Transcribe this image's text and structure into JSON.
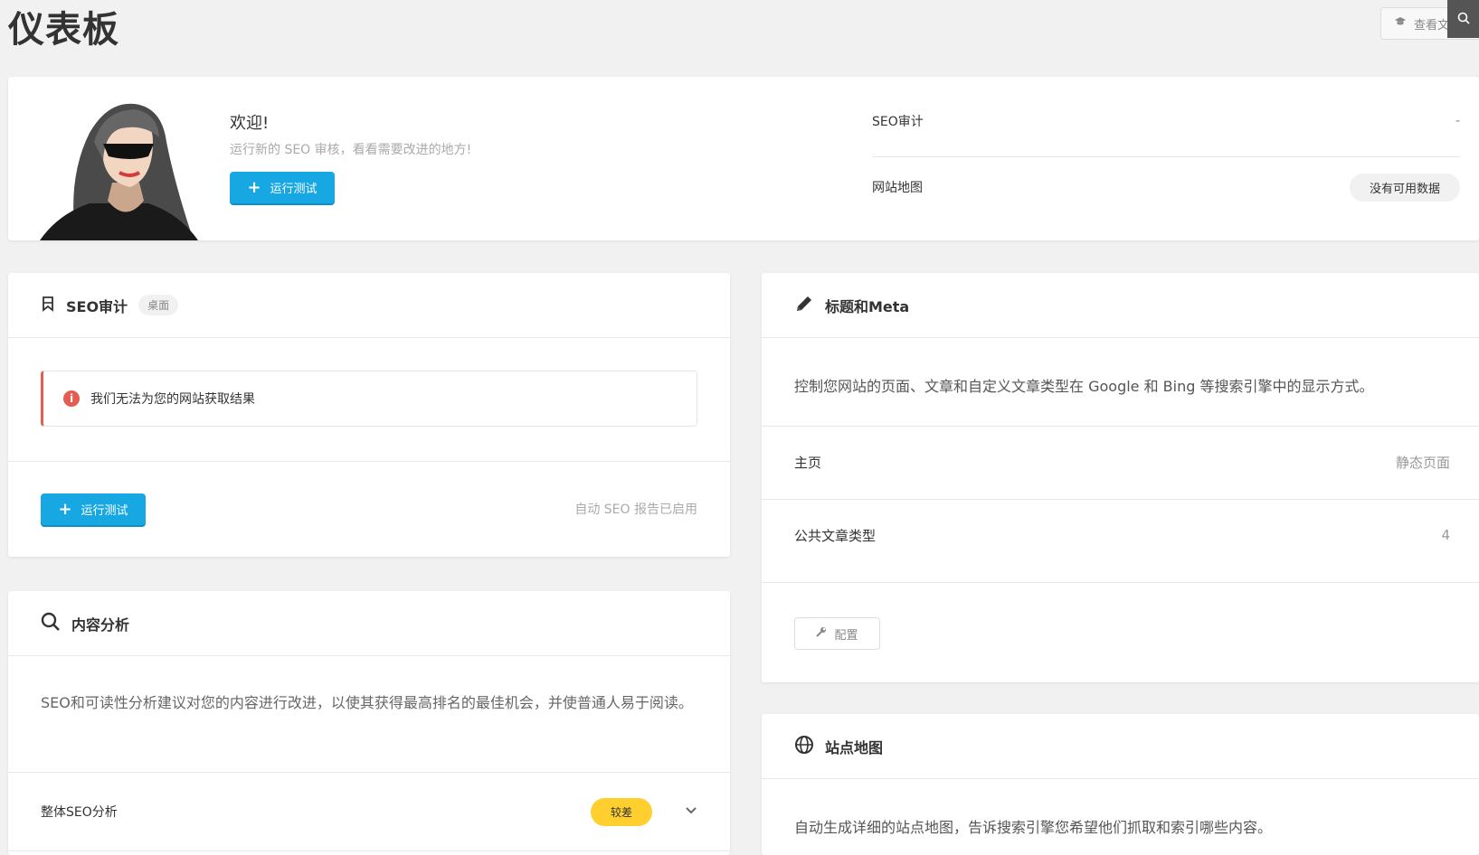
{
  "page": {
    "title": "仪表板",
    "doc_button": "查看文档"
  },
  "welcome": {
    "title": "欢迎!",
    "subtitle": "运行新的 SEO 审核，看看需要改进的地方!",
    "run_button": "运行测试",
    "stats": [
      {
        "label": "SEO审计",
        "value": "-"
      },
      {
        "label": "网站地图",
        "value": "没有可用数据"
      }
    ]
  },
  "seo_audit": {
    "title": "SEO审计",
    "tag": "桌面",
    "error": "我们无法为您的网站获取结果",
    "run_button": "运行测试",
    "auto_report": "自动 SEO 报告已启用"
  },
  "content_analysis": {
    "title": "内容分析",
    "description": "SEO和可读性分析建议对您的内容进行改进，以使其获得最高排名的最佳机会，并使普通人易于阅读。",
    "row_label": "整体SEO分析",
    "row_badge": "较差"
  },
  "titles_meta": {
    "title": "标题和Meta",
    "description": "控制您网站的页面、文章和自定义文章类型在 Google 和 Bing 等搜索引擎中的显示方式。",
    "rows": [
      {
        "label": "主页",
        "value": "静态页面"
      },
      {
        "label": "公共文章类型",
        "value": "4"
      }
    ],
    "config_button": "配置"
  },
  "sitemap": {
    "title": "站点地图",
    "description": "自动生成详细的站点地图，告诉搜索引擎您希望他们抓取和索引哪些内容。"
  },
  "colors": {
    "primary_blue": "#17a8e3",
    "error_red": "#e35d52",
    "warning_yellow": "#fecf2f"
  }
}
